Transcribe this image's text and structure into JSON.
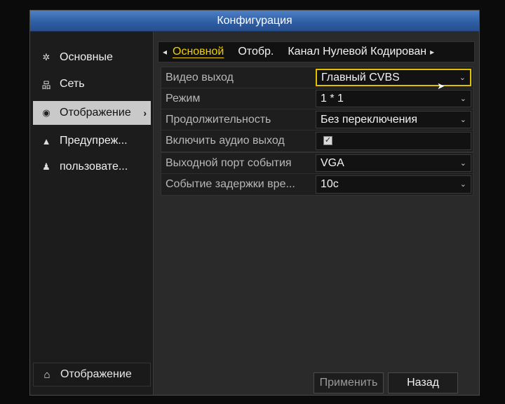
{
  "window": {
    "title": "Конфигурация"
  },
  "sidebar": {
    "items": [
      {
        "label": "Основные",
        "icon": "gear-icon",
        "glyph": "✲"
      },
      {
        "label": "Сеть",
        "icon": "network-icon",
        "glyph": "品"
      },
      {
        "label": "Отображение",
        "icon": "eye-icon",
        "glyph": "◉"
      },
      {
        "label": "Предупреж...",
        "icon": "warning-icon",
        "glyph": "▲"
      },
      {
        "label": "пользовате...",
        "icon": "users-icon",
        "glyph": "♟"
      }
    ],
    "active_arrow": "›",
    "bottom": {
      "label": "Отображение",
      "icon": "home-icon",
      "glyph": "⌂"
    }
  },
  "tabs": {
    "left_arrow": "◂",
    "right_arrow": "▸",
    "items": [
      "Основной",
      "Отобр.",
      "Канал Нулевой Кодирован"
    ]
  },
  "settings": {
    "video_output": {
      "label": "Видео выход",
      "value": "Главный CVBS"
    },
    "mode": {
      "label": "Режим",
      "value": "1 * 1"
    },
    "duration": {
      "label": "Продолжительность",
      "value": "Без переключения"
    },
    "audio_output": {
      "label": "Включить аудио выход",
      "checked": true,
      "check_glyph": "✓"
    },
    "event_port": {
      "label": "Выходной порт события",
      "value": "VGA"
    },
    "event_delay": {
      "label": "Событие задержки вре...",
      "value": "10с"
    },
    "chevron": "⌄"
  },
  "buttons": {
    "apply": "Применить",
    "back": "Назад"
  },
  "colors": {
    "title_bar": "#2f5fa6",
    "focus_border": "#e0c000",
    "active_tab": "#f0d000"
  }
}
